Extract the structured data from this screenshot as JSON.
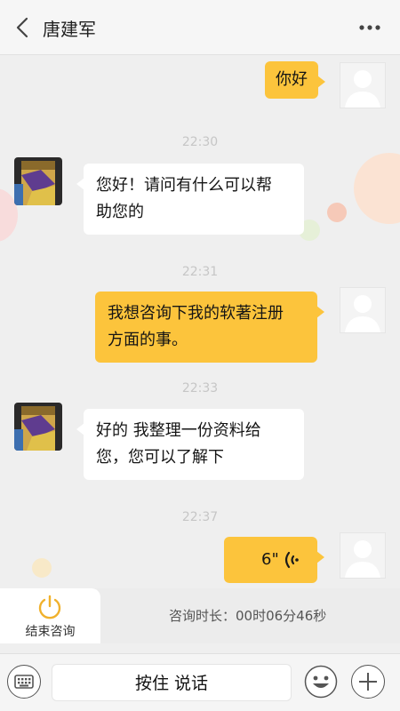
{
  "header": {
    "title": "唐建军",
    "back_icon": "chevron-left-icon",
    "more_icon": "more-dots-icon"
  },
  "messages": [
    {
      "type": "out",
      "text": "你好"
    },
    {
      "type": "time",
      "text": "22:30"
    },
    {
      "type": "in",
      "line1": "您好！请问有什么可以帮",
      "line2": "助您的"
    },
    {
      "type": "time",
      "text": "22:31"
    },
    {
      "type": "out",
      "line1": "我想咨询下我的软著注册",
      "line2": "方面的事。"
    },
    {
      "type": "time",
      "text": "22:33"
    },
    {
      "type": "in",
      "line1": "好的 我整理一份资料给",
      "line2": "您，您可以了解下"
    },
    {
      "type": "time",
      "text": "22:37"
    },
    {
      "type": "voice",
      "duration": "6\""
    }
  ],
  "consult": {
    "end_label": "结束咨询",
    "duration_text": "咨询时长：00时06分46秒"
  },
  "input": {
    "hold_to_talk": "按住 说话"
  },
  "colors": {
    "outgoing_bubble": "#fcc43c",
    "incoming_bubble": "#ffffff",
    "background": "#efefef"
  }
}
